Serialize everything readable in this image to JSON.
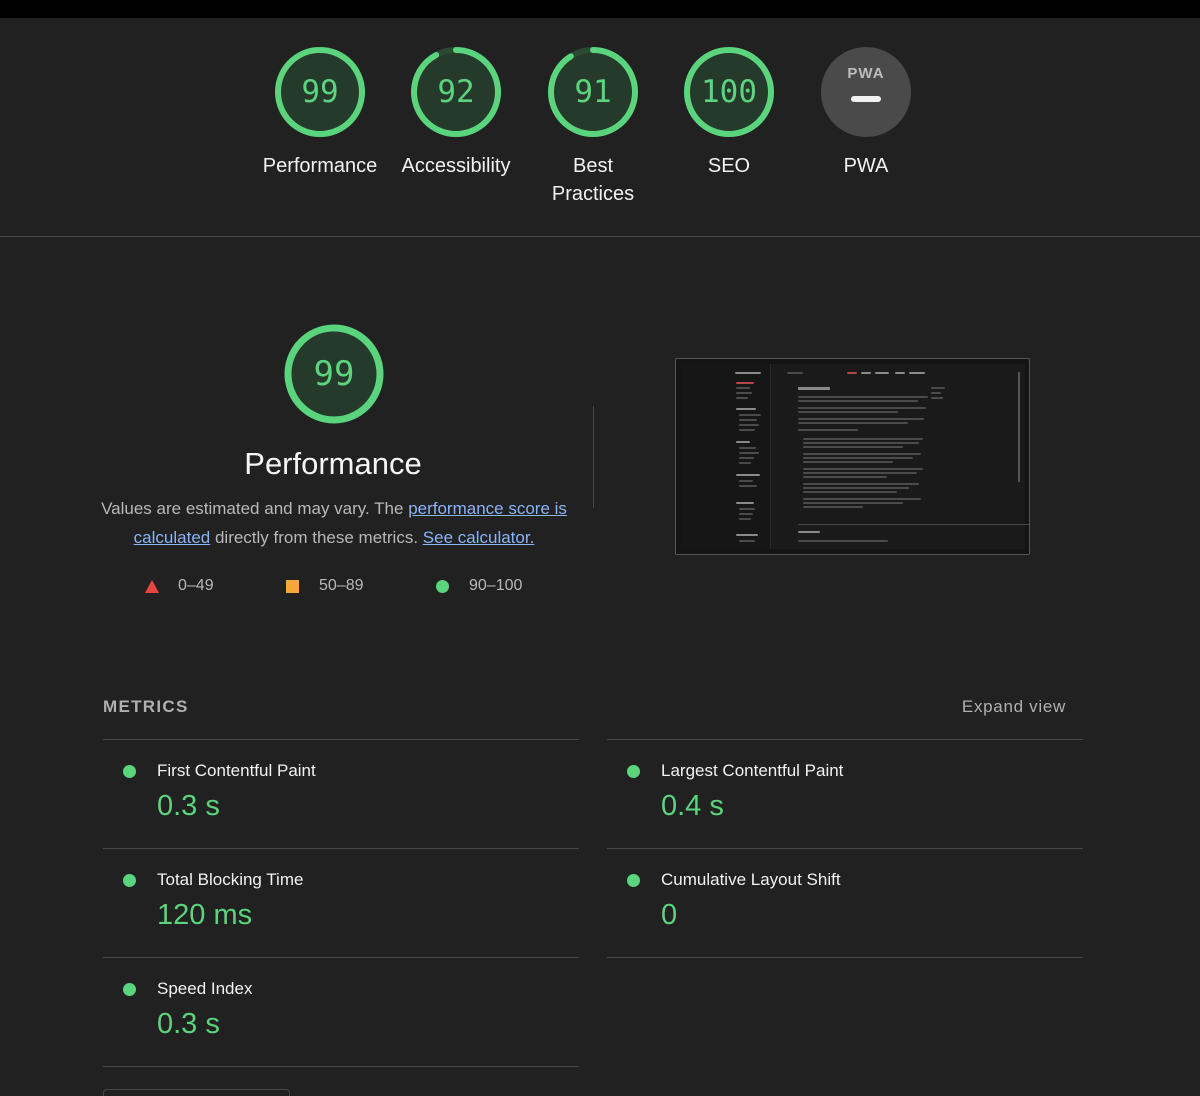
{
  "categories": [
    {
      "score": "99",
      "label": "Performance",
      "fraction": 0.99,
      "color": "#5bd47e"
    },
    {
      "score": "92",
      "label": "Accessibility",
      "fraction": 0.92,
      "color": "#5bd47e"
    },
    {
      "score": "91",
      "label": "Best Practices",
      "fraction": 0.91,
      "color": "#5bd47e"
    },
    {
      "score": "100",
      "label": "SEO",
      "fraction": 1.0,
      "color": "#5bd47e"
    },
    {
      "badge": "PWA",
      "label": "PWA"
    }
  ],
  "performance": {
    "score": "99",
    "fraction": 0.99,
    "title": "Performance",
    "desc_part1": "Values are estimated and may vary. The ",
    "desc_link1": "performance score is calculated",
    "desc_part2": " directly from these metrics. ",
    "desc_link2": "See calculator."
  },
  "legend": [
    {
      "range": "0–49",
      "shape": "triangle",
      "color": "#e8453c"
    },
    {
      "range": "50–89",
      "shape": "square",
      "color": "#f5a83a"
    },
    {
      "range": "90–100",
      "shape": "circle",
      "color": "#5bd47e"
    }
  ],
  "metrics": {
    "heading": "METRICS",
    "expand_label": "Expand view",
    "items": [
      {
        "name": "First Contentful Paint",
        "value": "0.3 s"
      },
      {
        "name": "Largest Contentful Paint",
        "value": "0.4 s"
      },
      {
        "name": "Total Blocking Time",
        "value": "120 ms"
      },
      {
        "name": "Cumulative Layout Shift",
        "value": "0"
      },
      {
        "name": "Speed Index",
        "value": "0.3 s"
      }
    ]
  },
  "colors": {
    "pass": "#5bd47e",
    "background": "#212121",
    "link": "#8ab4f8"
  }
}
